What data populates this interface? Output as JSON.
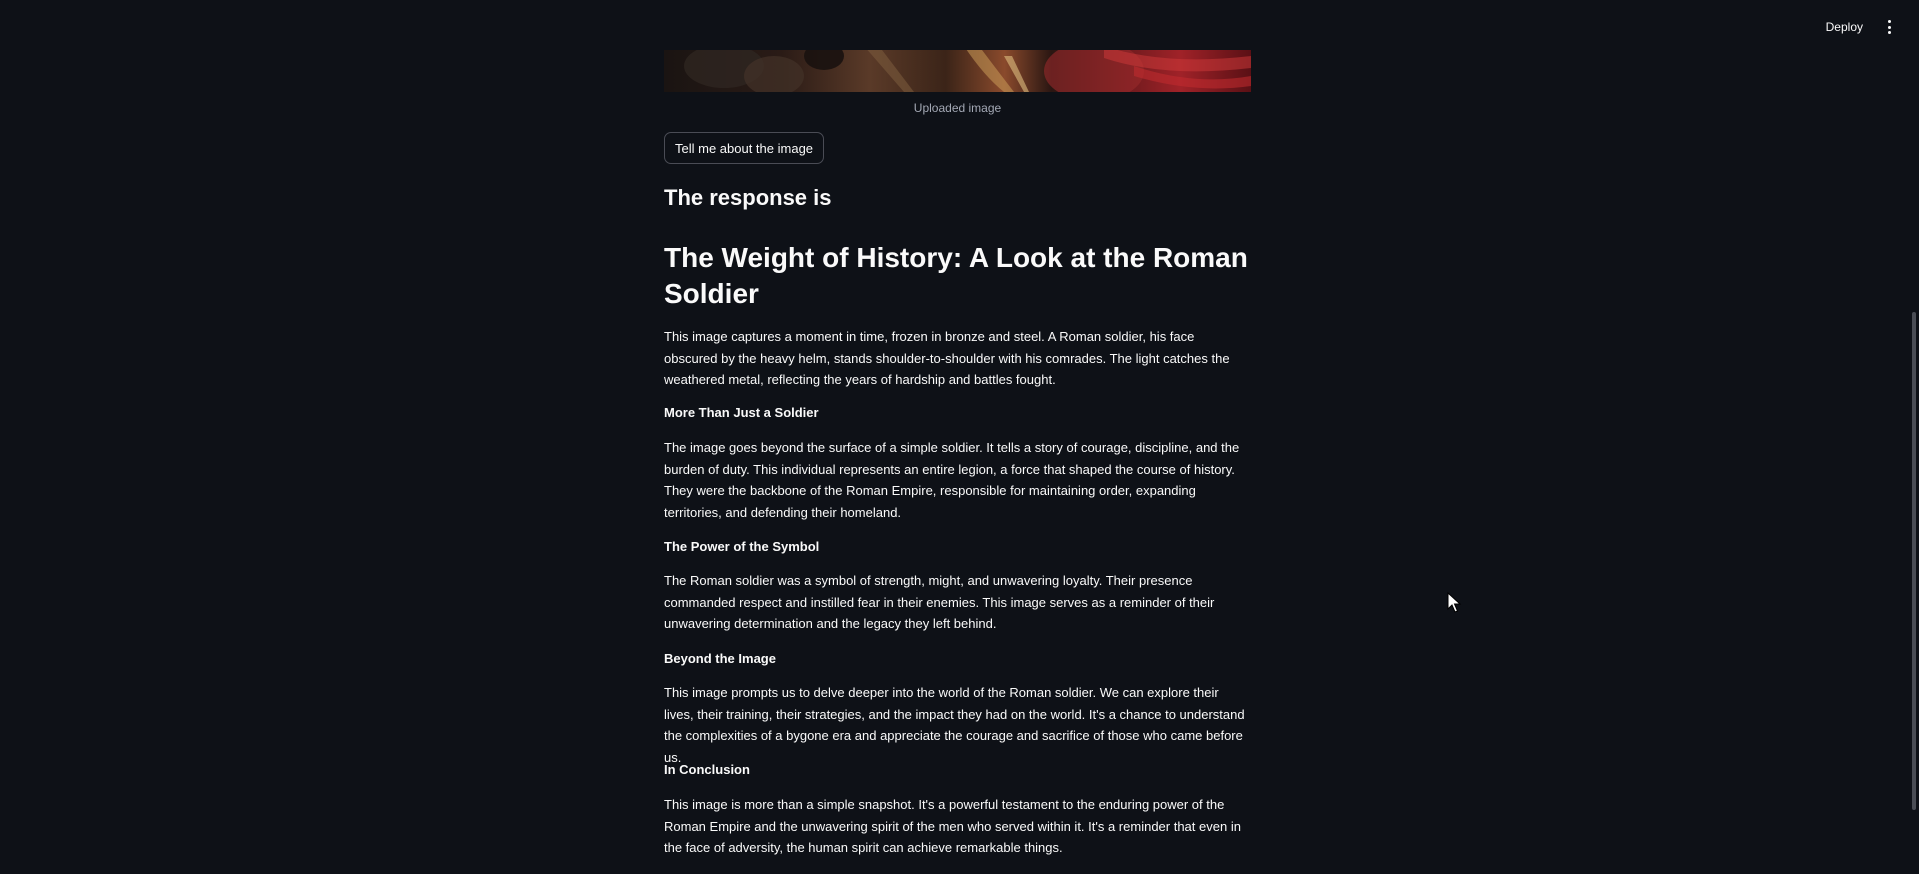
{
  "header": {
    "deploy_label": "Deploy",
    "menu_icon": "kebab-menu-icon"
  },
  "uploaded_image": {
    "caption": "Uploaded image"
  },
  "actions": {
    "describe_label": "Tell me about the image"
  },
  "response": {
    "heading": "The response is",
    "title": "The Weight of History: A Look at the Roman Soldier",
    "intro": "This image captures a moment in time, frozen in bronze and steel. A Roman soldier, his face obscured by the heavy helm, stands shoulder-to-shoulder with his comrades. The light catches the weathered metal, reflecting the years of hardship and battles fought.",
    "sections": [
      {
        "title": "More Than Just a Soldier",
        "text": "The image goes beyond the surface of a simple soldier. It tells a story of courage, discipline, and the burden of duty. This individual represents an entire legion, a force that shaped the course of history. They were the backbone of the Roman Empire, responsible for maintaining order, expanding territories, and defending their homeland."
      },
      {
        "title": "The Power of the Symbol",
        "text": "The Roman soldier was a symbol of strength, might, and unwavering loyalty. Their presence commanded respect and instilled fear in their enemies. This image serves as a reminder of their unwavering determination and the legacy they left behind."
      },
      {
        "title": "Beyond the Image",
        "text": "This image prompts us to delve deeper into the world of the Roman soldier. We can explore their lives, their training, their strategies, and the impact they had on the world. It's a chance to understand the complexities of a bygone era and appreciate the courage and sacrifice of those who came before us."
      },
      {
        "title": "In Conclusion",
        "text": "This image is more than a simple snapshot. It's a powerful testament to the enduring power of the Roman Empire and the unwavering spirit of the men who served within it. It's a reminder that even in the face of adversity, the human spirit can achieve remarkable things."
      }
    ]
  },
  "colors": {
    "background": "#0e1117",
    "text": "#fafafa",
    "caption": "#a3a8b4",
    "button_border": "#4a4c55"
  }
}
